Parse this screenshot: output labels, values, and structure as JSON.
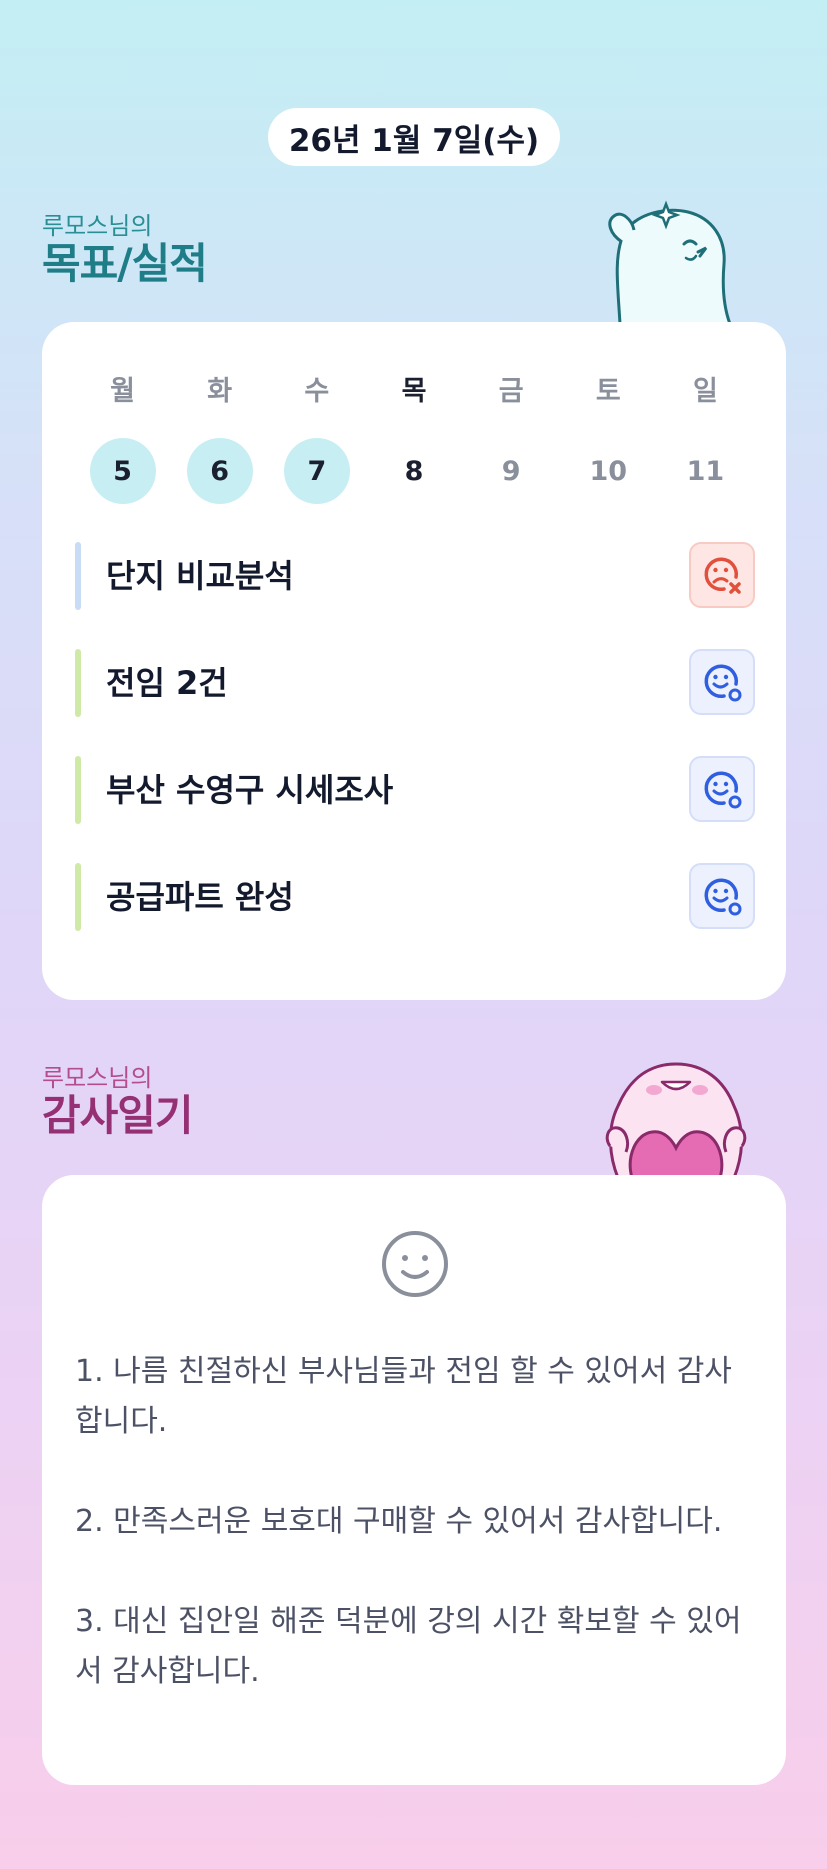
{
  "date_label": "26년 1월 7일(수)",
  "goals_section": {
    "subtitle": "루모스님의",
    "title": "목표/실적"
  },
  "calendar": {
    "days": [
      {
        "dow": "월",
        "num": "5",
        "state": "done"
      },
      {
        "dow": "화",
        "num": "6",
        "state": "done"
      },
      {
        "dow": "수",
        "num": "7",
        "state": "done"
      },
      {
        "dow": "목",
        "num": "8",
        "state": "today"
      },
      {
        "dow": "금",
        "num": "9",
        "state": "future"
      },
      {
        "dow": "토",
        "num": "10",
        "state": "future"
      },
      {
        "dow": "일",
        "num": "11",
        "state": "future"
      }
    ]
  },
  "goals": [
    {
      "text": "단지 비교분석",
      "status": "fail",
      "bar_color": "#c9dcf5",
      "icon": "sad-face-x-icon"
    },
    {
      "text": "전임 2건",
      "status": "ok",
      "bar_color": "#cfeaa6",
      "icon": "smile-check-icon"
    },
    {
      "text": "부산 수영구 시세조사",
      "status": "ok",
      "bar_color": "#cfeaa6",
      "icon": "smile-check-icon"
    },
    {
      "text": "공급파트 완성",
      "status": "ok",
      "bar_color": "#cfeaa6",
      "icon": "smile-check-icon"
    }
  ],
  "gratitude_section": {
    "subtitle": "루모스님의",
    "title": "감사일기"
  },
  "gratitude": {
    "icon": "smiley-icon",
    "entries": [
      "1. 나름 친절하신 부사님들과 전임 할 수 있어서 감사합니다.",
      "2. 만족스러운 보호대 구매할 수 있어서 감사합니다.",
      "3. 대신 집안일 해준 덕분에 강의 시간 확보할 수 있어서 감사합니다."
    ]
  },
  "colors": {
    "done_day": "#c7eef3",
    "fail_icon": "#e0503c",
    "ok_icon": "#2f5fe0",
    "goal_title": "#1e7d86",
    "gratitude_title": "#963074"
  }
}
